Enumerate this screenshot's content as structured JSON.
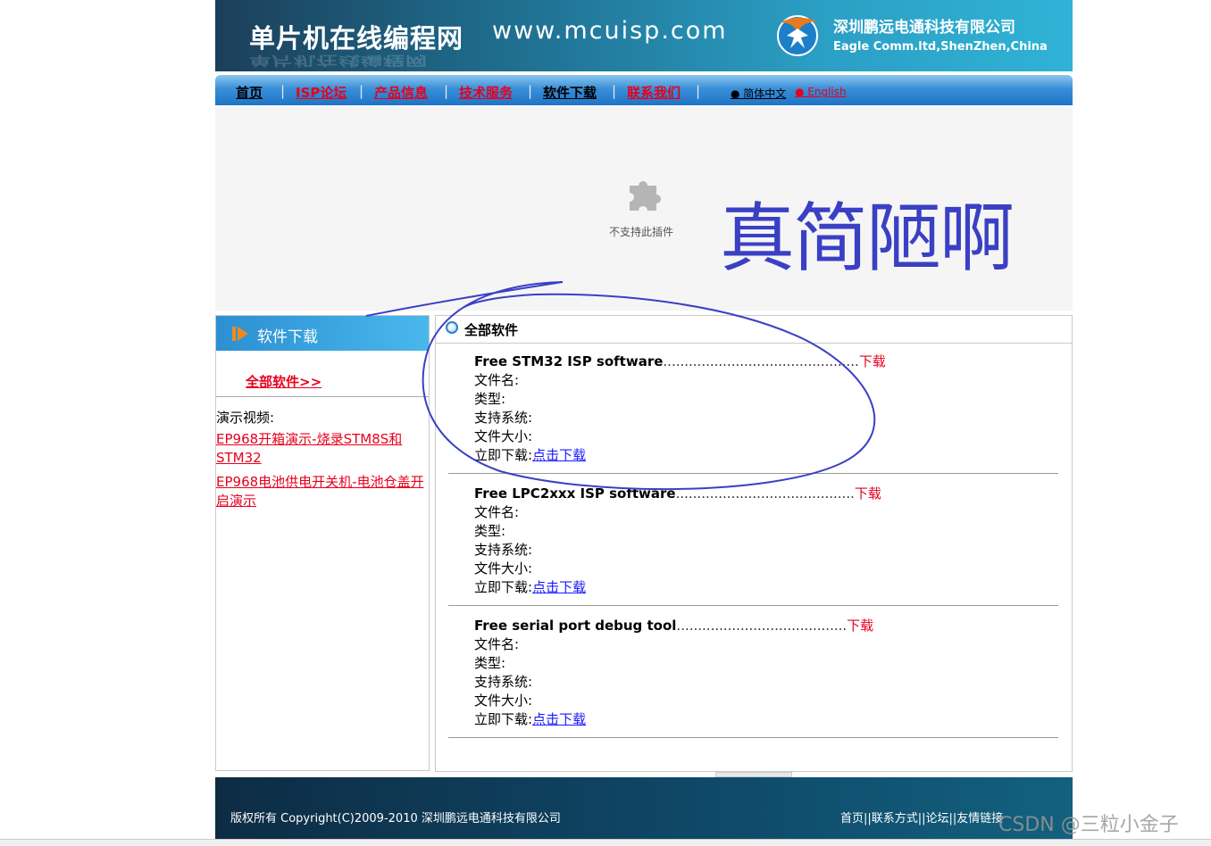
{
  "header": {
    "site_title": "单片机在线编程网",
    "site_url": "www.mcuisp.com",
    "company_name": "深圳鹏远电通科技有限公司",
    "company_name_en": "Eagle Comm.ltd,ShenZhen,China",
    "logo_icon": "eagle-logo-icon"
  },
  "nav": {
    "items": [
      {
        "label": "首页",
        "style": "dark"
      },
      {
        "label": "ISP论坛",
        "style": "red"
      },
      {
        "label": "产品信息",
        "style": "red"
      },
      {
        "label": "技术服务",
        "style": "red"
      },
      {
        "label": "软件下载",
        "style": "dark"
      },
      {
        "label": "联系我们",
        "style": "red"
      }
    ],
    "separator": "|",
    "lang_cn": "● 简体中文",
    "lang_en": "● English"
  },
  "plugin": {
    "message": "不支持此插件",
    "icon": "puzzle-piece-icon",
    "annotation_text": "真简陋啊"
  },
  "sidebar": {
    "heading": "软件下载",
    "all_software": "全部软件>>",
    "video_label": "演示视频:",
    "videos": [
      "EP968开箱演示-烧录STM8S和STM32",
      "EP968电池供电开关机-电池仓盖开启演示"
    ]
  },
  "main": {
    "heading": "全部软件",
    "fields": {
      "filename": "文件名:",
      "type": "类型:",
      "os": "支持系统:",
      "size": "文件大小:",
      "download_now": "立即下载:",
      "download_link": "点击下载",
      "download": "下载"
    },
    "entries": [
      {
        "name": "Free STM32 ISP software",
        "dots": ".............................................."
      },
      {
        "name": "Free LPC2xxx ISP software",
        "dots": ".........................................."
      },
      {
        "name": "Free serial port debug tool",
        "dots": "........................................"
      }
    ]
  },
  "footer": {
    "copyright": "版权所有 Copyright(C)2009-2010 深圳鹏远电通科技有限公司",
    "links": "首页||联系方式||论坛||友情链接"
  },
  "watermark": "CSDN @三粒小金子",
  "colors": {
    "link_red": "#e8001c",
    "link_blue": "#1a1aff",
    "annotation_blue": "#3a40c4",
    "nav_blue": "#1f73c6"
  }
}
